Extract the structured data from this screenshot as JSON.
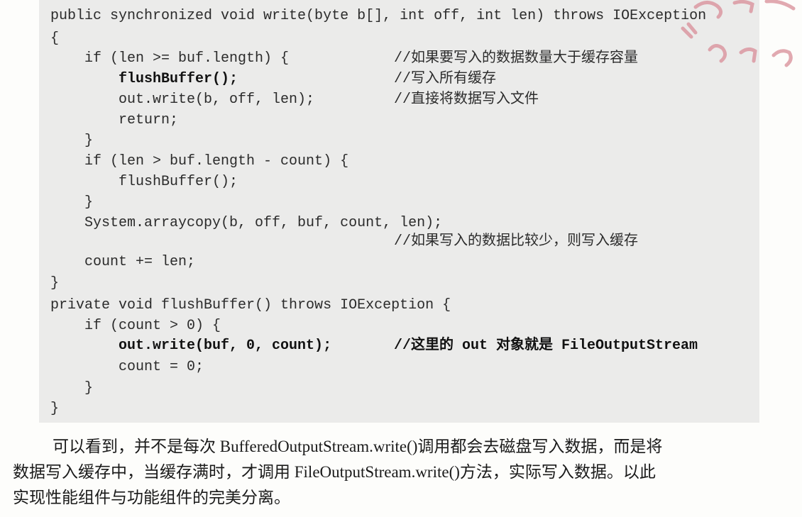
{
  "code": {
    "lines": [
      {
        "text": "public synchronized void write(byte b[], int off, int len) throws IOException"
      },
      {
        "text": "{"
      },
      {
        "text": "    if (len >= buf.length) {",
        "comment": "//如果要写入的数据数量大于缓存容量"
      },
      {
        "text": "        flushBuffer();",
        "comment": "//写入所有缓存",
        "bold_part": "flushBuffer"
      },
      {
        "text": "        out.write(b, off, len);",
        "comment": "//直接将数据写入文件"
      },
      {
        "text": "        return;"
      },
      {
        "text": "    }"
      },
      {
        "text": "    if (len > buf.length - count) {"
      },
      {
        "text": "        flushBuffer();"
      },
      {
        "text": "    }"
      },
      {
        "text": "    System.arraycopy(b, off, buf, count, len);"
      },
      {
        "text": "",
        "comment": "//如果写入的数据比较少，则写入缓存"
      },
      {
        "text": "    count += len;"
      },
      {
        "text": "}"
      },
      {
        "text": "private void flushBuffer() throws IOException {"
      },
      {
        "text": "    if (count > 0) {"
      },
      {
        "text": "        out.write(buf, 0, count);",
        "comment": "//这里的 out 对象就是 FileOutputStream",
        "bold": true
      },
      {
        "text": "        count = 0;"
      },
      {
        "text": "    }"
      },
      {
        "text": "}"
      }
    ]
  },
  "paragraph": {
    "line1": "可以看到，并不是每次 BufferedOutputStream.write()调用都会去磁盘写入数据，而是将",
    "line2": "数据写入缓存中，当缓存满时，才调用 FileOutputStream.write()方法，实际写入数据。以此",
    "line3": "实现性能组件与功能组件的完美分离。"
  },
  "colors": {
    "code_background": "#ebebea",
    "stamp": "#d9909a"
  }
}
